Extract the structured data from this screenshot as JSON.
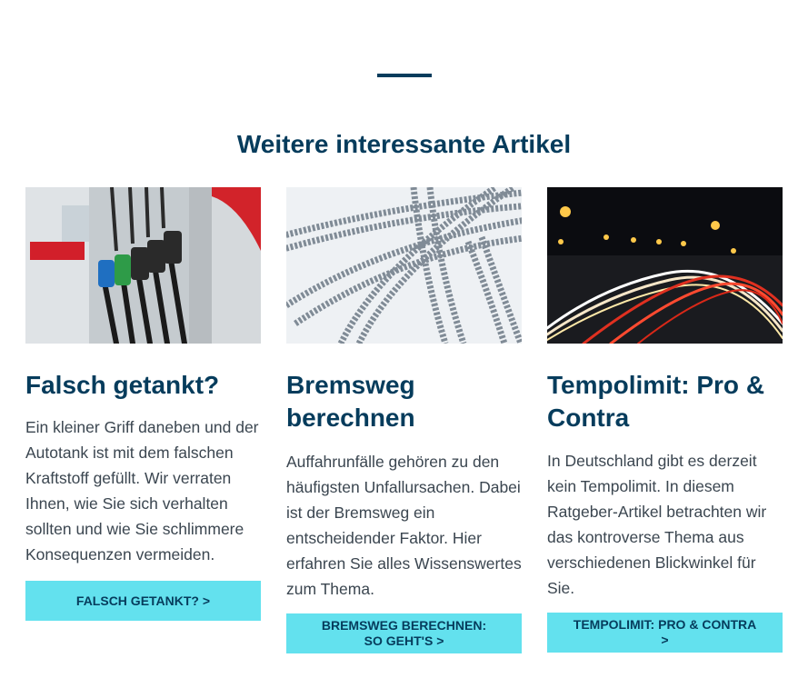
{
  "section": {
    "title": "Weitere interessante Artikel"
  },
  "cards": [
    {
      "image": "fuel-pump-nozzles-photo",
      "title": "Falsch getankt?",
      "text": "Ein kleiner Griff daneben und der Autotank ist mit dem falschen Kraftstoff gefüllt. Wir verraten Ihnen, wie Sie sich verhalten sollten und wie Sie schlimmere Konsequenzen vermeiden.",
      "button": "FALSCH GETANKT? >"
    },
    {
      "image": "tire-tracks-in-snow-photo",
      "title": "Bremsweg berechnen",
      "text": "Auffahrunfälle gehören zu den häufigsten Unfallursachen. Dabei ist der Bremsweg ein entscheidender Faktor. Hier erfahren Sie alles Wissenswertes zum Thema.",
      "button": "BREMSWEG BERECHNEN: SO GEHT'S >"
    },
    {
      "image": "highway-night-light-trails-photo",
      "title": "Tempolimit: Pro & Contra",
      "text": "In Deutschland gibt es derzeit kein Tempolimit. In diesem Ratgeber-Artikel betrachten wir das kontroverse Thema aus verschiedenen Blickwinkel für Sie.",
      "button": "TEMPOLIMIT: PRO & CONTRA >"
    }
  ],
  "colors": {
    "heading": "#063c5c",
    "button": "#63e1ee",
    "text": "#3b4650"
  }
}
